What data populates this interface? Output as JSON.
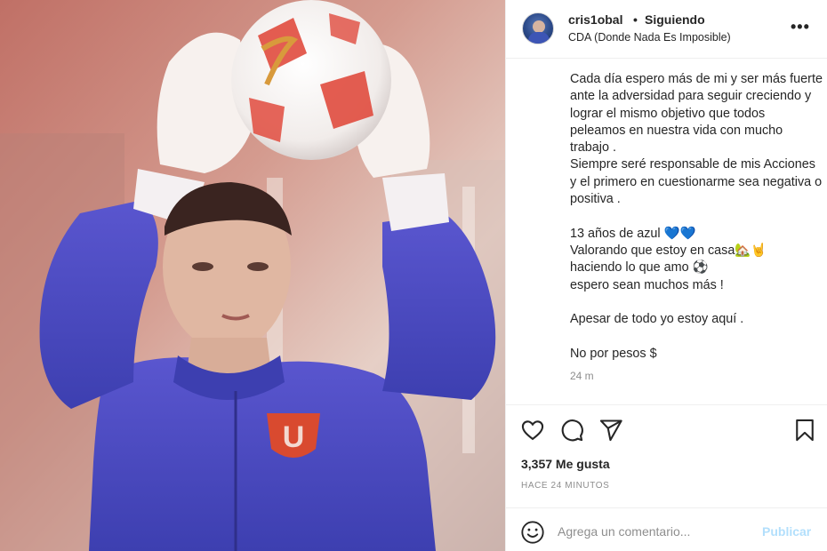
{
  "photo": {
    "jersey_crest": "U"
  },
  "header": {
    "username": "cris1obal",
    "separator": "•",
    "follow_status": "Siguiendo",
    "location": "CDA (Donde Nada Es Imposible)",
    "more_icon": "more-horizontal-icon",
    "more_label": "•••"
  },
  "caption": {
    "text": "Cada día espero más de mi y ser más fuerte ante la adversidad para seguir creciendo y lograr el mismo objetivo que todos peleamos en nuestra vida con mucho trabajo .\nSiempre seré responsable de mis Acciones y el primero en cuestionarme sea negativa o positiva .\n\n13 años de azul 💙💙\nValorando que estoy en casa🏡🤘\nhaciendo lo que amo ⚽\nespero sean muchos más !\n\nApesar de todo yo estoy aquí .\n\nNo por pesos $",
    "timestamp": "24 m"
  },
  "actions": {
    "like_icon": "heart-icon",
    "comment_icon": "comment-bubble-icon",
    "share_icon": "paper-plane-icon",
    "save_icon": "bookmark-icon"
  },
  "stats": {
    "likes": "3,357 Me gusta",
    "posted_ago": "HACE 24 MINUTOS"
  },
  "comment": {
    "emoji_icon": "smiley-icon",
    "placeholder": "Agrega un comentario...",
    "publish_label": "Publicar"
  },
  "colors": {
    "publish_disabled": "#b2dffc",
    "jersey": "#4a4fc4",
    "crest": "#d94a2f"
  }
}
